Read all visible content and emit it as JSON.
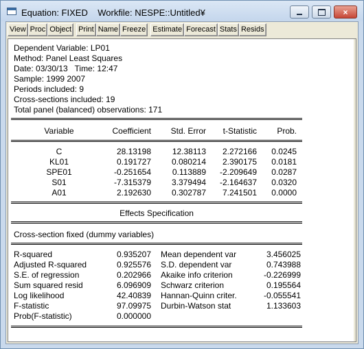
{
  "window": {
    "title": "Equation: FIXED    Workfile: NESPE::Untitled¥",
    "controls": {
      "minimize": "minimize",
      "maximize": "maximize",
      "close": "×"
    }
  },
  "toolbar": {
    "buttons": [
      "View",
      "Proc",
      "Object",
      "Print",
      "Name",
      "Freeze",
      "Estimate",
      "Forecast",
      "Stats",
      "Resids"
    ]
  },
  "header": [
    "Dependent Variable: LP01",
    "Method: Panel Least Squares",
    "Date: 03/30/13   Time: 12:47",
    "Sample: 1999 2007",
    "Periods included: 9",
    "Cross-sections included: 19",
    "Total panel (balanced) observations: 171"
  ],
  "coef_table": {
    "columns": [
      "Variable",
      "Coefficient",
      "Std. Error",
      "t-Statistic",
      "Prob."
    ],
    "rows": [
      [
        "C",
        "28.13198",
        "12.38113",
        "2.272166",
        "0.0245"
      ],
      [
        "KL01",
        "0.191727",
        "0.080214",
        "2.390175",
        "0.0181"
      ],
      [
        "SPE01",
        "-0.251654",
        "0.113889",
        "-2.209649",
        "0.0287"
      ],
      [
        "S01",
        "-7.315379",
        "3.379494",
        "-2.164637",
        "0.0320"
      ],
      [
        "A01",
        "2.192630",
        "0.302787",
        "7.241501",
        "0.0000"
      ]
    ]
  },
  "effects": {
    "title": "Effects Specification",
    "spec": "Cross-section fixed (dummy variables)"
  },
  "stats": [
    [
      "R-squared",
      "0.935207",
      "Mean dependent var",
      "3.456025"
    ],
    [
      "Adjusted R-squared",
      "0.925576",
      "S.D. dependent var",
      "0.743988"
    ],
    [
      "S.E. of regression",
      "0.202966",
      "Akaike info criterion",
      "-0.226999"
    ],
    [
      "Sum squared resid",
      "6.096909",
      "Schwarz criterion",
      "0.195564"
    ],
    [
      "Log likelihood",
      "42.40839",
      "Hannan-Quinn criter.",
      "-0.055541"
    ],
    [
      "F-statistic",
      "97.09975",
      "Durbin-Watson stat",
      "1.133603"
    ],
    [
      "Prob(F-statistic)",
      "0.000000",
      "",
      ""
    ]
  ]
}
